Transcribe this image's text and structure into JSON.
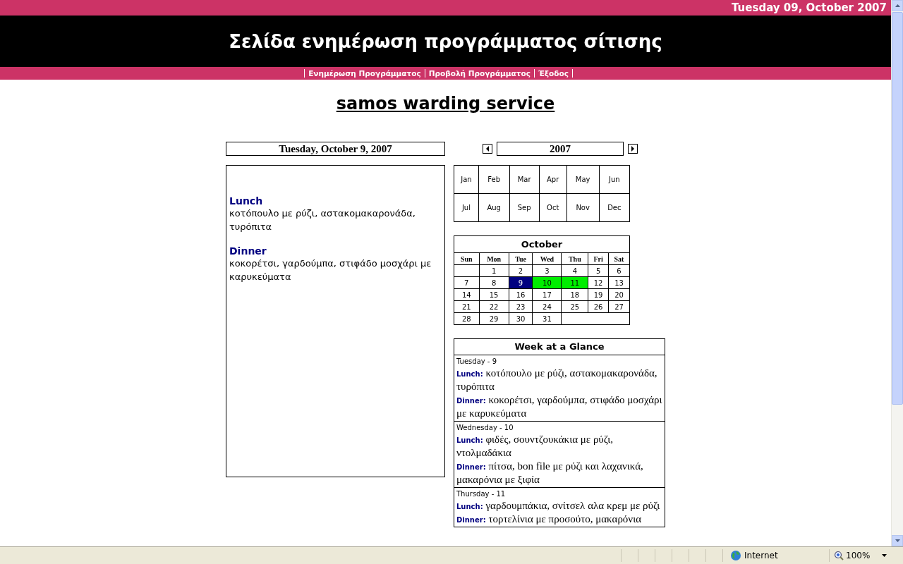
{
  "top_bar": {
    "date": "Tuesday 09, October 2007"
  },
  "header": {
    "title": "Σελίδα ενημέρωση προγράμματος σίτισης"
  },
  "nav": [
    {
      "label": "Ενημέρωση Προγράμματος"
    },
    {
      "label": "Προβολή Προγράμματος"
    },
    {
      "label": "Έξοδος"
    }
  ],
  "site_title": "samos warding service",
  "day_view": {
    "date": "Tuesday, October 9, 2007",
    "meals": [
      {
        "label": "Lunch",
        "dishes": "κοτόπουλο με ρύζι, αστακομακαρονάδα, τυρόπιτα"
      },
      {
        "label": "Dinner",
        "dishes": "κοκορέτσι, γαρδούμπα, στιφάδο μοσχάρι με καρυκεύματα"
      }
    ]
  },
  "year": "2007",
  "months": [
    "Jan",
    "Feb",
    "Mar",
    "Apr",
    "May",
    "Jun",
    "Jul",
    "Aug",
    "Sep",
    "Oct",
    "Nov",
    "Dec"
  ],
  "month_calendar": {
    "title": "October",
    "weekdays": [
      "Sun",
      "Mon",
      "Tue",
      "Wed",
      "Thu",
      "Fri",
      "Sat"
    ],
    "weeks": [
      [
        {
          "day": "1",
          "selected": false,
          "highlighted": false
        },
        {
          "day": "2",
          "selected": false,
          "highlighted": false
        },
        {
          "day": "3",
          "selected": false,
          "highlighted": false
        },
        {
          "day": "4",
          "selected": false,
          "highlighted": false
        },
        {
          "day": "5",
          "selected": false,
          "highlighted": false
        },
        {
          "day": "6",
          "selected": false,
          "highlighted": false
        }
      ],
      [
        {
          "day": "7",
          "selected": false,
          "highlighted": false
        },
        {
          "day": "8",
          "selected": false,
          "highlighted": false
        },
        {
          "day": "9",
          "selected": true,
          "highlighted": false
        },
        {
          "day": "10",
          "selected": false,
          "highlighted": true
        },
        {
          "day": "11",
          "selected": false,
          "highlighted": true
        },
        {
          "day": "12",
          "selected": false,
          "highlighted": false
        },
        {
          "day": "13",
          "selected": false,
          "highlighted": false
        }
      ],
      [
        {
          "day": "14",
          "selected": false,
          "highlighted": false
        },
        {
          "day": "15",
          "selected": false,
          "highlighted": false
        },
        {
          "day": "16",
          "selected": false,
          "highlighted": false
        },
        {
          "day": "17",
          "selected": false,
          "highlighted": false
        },
        {
          "day": "18",
          "selected": false,
          "highlighted": false
        },
        {
          "day": "19",
          "selected": false,
          "highlighted": false
        },
        {
          "day": "20",
          "selected": false,
          "highlighted": false
        }
      ],
      [
        {
          "day": "21",
          "selected": false,
          "highlighted": false
        },
        {
          "day": "22",
          "selected": false,
          "highlighted": false
        },
        {
          "day": "23",
          "selected": false,
          "highlighted": false
        },
        {
          "day": "24",
          "selected": false,
          "highlighted": false
        },
        {
          "day": "25",
          "selected": false,
          "highlighted": false
        },
        {
          "day": "26",
          "selected": false,
          "highlighted": false
        },
        {
          "day": "27",
          "selected": false,
          "highlighted": false
        }
      ],
      [
        {
          "day": "28",
          "selected": false,
          "highlighted": false
        },
        {
          "day": "29",
          "selected": false,
          "highlighted": false
        },
        {
          "day": "30",
          "selected": false,
          "highlighted": false
        },
        {
          "day": "31",
          "selected": false,
          "highlighted": false
        }
      ]
    ]
  },
  "week_glance": {
    "title": "Week at a Glance",
    "days": [
      {
        "heading": "Tuesday - 9",
        "meals": [
          {
            "label": "Lunch:",
            "dishes": "κοτόπουλο με ρύζι, αστακομακαρονάδα, τυρόπιτα"
          },
          {
            "label": "Dinner:",
            "dishes": "κοκορέτσι, γαρδούμπα, στιφάδο μοσχάρι με καρυκεύματα"
          }
        ]
      },
      {
        "heading": "Wednesday - 10",
        "meals": [
          {
            "label": "Lunch:",
            "dishes": "φιδές, σουντζουκάκια με ρύζι, ντολμαδάκια"
          },
          {
            "label": "Dinner:",
            "dishes": "πίτσα, bon file με ρύζι και λαχανικά, μακαρόνια με ξιφία"
          }
        ]
      },
      {
        "heading": "Thursday - 11",
        "meals": [
          {
            "label": "Lunch:",
            "dishes": "γαρδουμπάκια, σνίτσελ αλα κρεμ με ρύζι"
          },
          {
            "label": "Dinner:",
            "dishes": "τορτελίνια με προσούτο, μακαρόνια"
          }
        ]
      }
    ]
  },
  "status_bar": {
    "zone": "Internet",
    "zoom": "100%"
  }
}
